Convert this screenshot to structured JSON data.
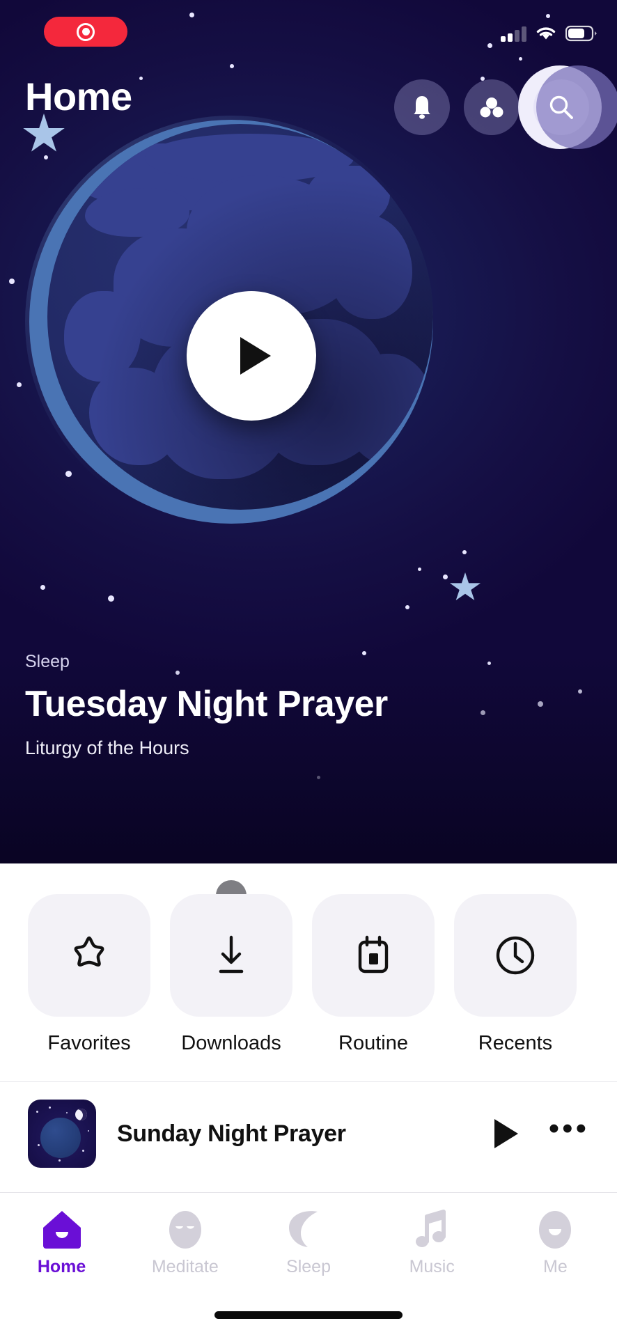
{
  "status_bar": {
    "recording_label": "record-indicator",
    "signal_bars_total": 4,
    "signal_bars_filled": 2,
    "wifi": "wifi-icon",
    "battery_percent": 65
  },
  "header": {
    "title": "Home",
    "buttons": [
      {
        "name": "notifications",
        "icon": "bell-icon"
      },
      {
        "name": "community",
        "icon": "people-group-icon"
      },
      {
        "name": "search",
        "icon": "search-icon"
      }
    ]
  },
  "hero": {
    "eyebrow": "Sleep",
    "title": "Tuesday Night Prayer",
    "subtitle": "Liturgy of the Hours",
    "play_button": "play-icon"
  },
  "quick_actions": [
    {
      "label": "Favorites",
      "icon": "star-icon"
    },
    {
      "label": "Downloads",
      "icon": "download-icon"
    },
    {
      "label": "Routine",
      "icon": "calendar-icon"
    },
    {
      "label": "Recents",
      "icon": "clock-icon"
    }
  ],
  "list": {
    "items": [
      {
        "title": "Sunday Night Prayer",
        "thumbnail": "night-globe-thumbnail",
        "play": "play-icon",
        "more": "•••"
      }
    ]
  },
  "tabbar": {
    "active": "Home",
    "accent_color": "#6a0fd6",
    "inactive_color": "#c9c7d2",
    "items": [
      {
        "label": "Home",
        "icon": "home-icon"
      },
      {
        "label": "Meditate",
        "icon": "face-meditate-icon"
      },
      {
        "label": "Sleep",
        "icon": "moon-icon"
      },
      {
        "label": "Music",
        "icon": "music-note-icon"
      },
      {
        "label": "Me",
        "icon": "face-profile-icon"
      }
    ]
  },
  "colors": {
    "hero_bg": "#150f44",
    "globe_land": "#364190",
    "globe_ocean": "#222a66",
    "record_red": "#f4283c",
    "tile_bg": "#f3f2f7"
  }
}
